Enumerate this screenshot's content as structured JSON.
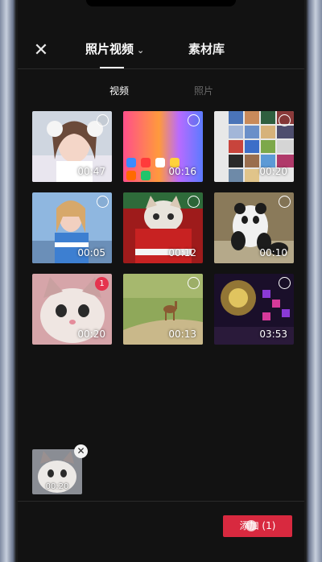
{
  "header": {
    "close_icon": "close-icon",
    "tabs": [
      {
        "label": "照片视频",
        "active": true
      },
      {
        "label": "素材库",
        "active": false
      }
    ]
  },
  "subtabs": [
    {
      "label": "视频",
      "active": true
    },
    {
      "label": "照片",
      "active": false
    }
  ],
  "media": [
    {
      "duration": "00:47",
      "selected": false
    },
    {
      "duration": "00:16",
      "selected": false
    },
    {
      "duration": "00:20",
      "selected": false
    },
    {
      "duration": "00:05",
      "selected": false
    },
    {
      "duration": "00:12",
      "selected": false
    },
    {
      "duration": "00:10",
      "selected": false
    },
    {
      "duration": "00:20",
      "selected": true,
      "order": "1"
    },
    {
      "duration": "00:13",
      "selected": false
    },
    {
      "duration": "03:53",
      "selected": false
    }
  ],
  "tray": {
    "items": [
      {
        "duration": "00:20"
      }
    ],
    "remove_icon": "close-icon"
  },
  "add_button": {
    "label": "添加 (1)"
  },
  "colors": {
    "accent": "#d8293f",
    "background": "#121212"
  }
}
